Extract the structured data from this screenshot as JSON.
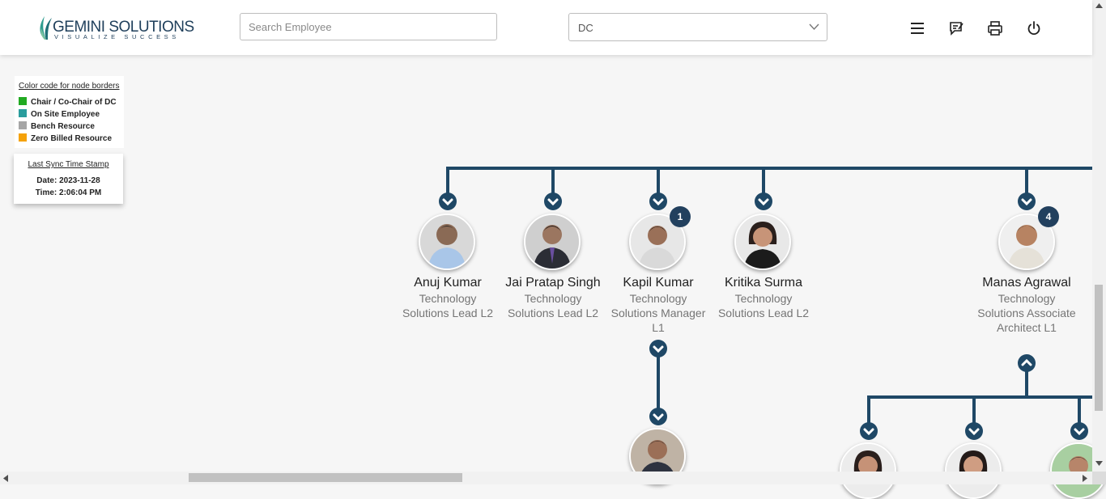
{
  "header": {
    "brand_name": "GEMINI SOLUTIONS",
    "brand_tagline": "VISUALIZE SUCCESS",
    "search_placeholder": "Search Employee",
    "department_value": "DC",
    "icons": [
      "menu-icon",
      "feedback-icon",
      "print-icon",
      "power-icon"
    ]
  },
  "legend": {
    "title": "Color code for node borders",
    "items": [
      {
        "label": "Chair / Co-Chair of DC",
        "color": "#22aa22"
      },
      {
        "label": "On Site Employee",
        "color": "#2a9d9d"
      },
      {
        "label": "Bench Resource",
        "color": "#a6a6a6"
      },
      {
        "label": "Zero Billed Resource",
        "color": "#f5a20a"
      }
    ]
  },
  "sync": {
    "title": "Last Sync Time Stamp",
    "date": "Date: 2023-11-28",
    "time": "Time: 2:06:04 PM"
  },
  "employees": [
    {
      "name": "Anuj Kumar",
      "title": "Technology Solutions Lead L2",
      "reports": null
    },
    {
      "name": "Jai Pratap Singh",
      "title": "Technology Solutions Lead L2",
      "reports": null
    },
    {
      "name": "Kapil Kumar",
      "title": "Technology Solutions Manager L1",
      "reports": "1"
    },
    {
      "name": "Kritika Surma",
      "title": "Technology Solutions Lead L2",
      "reports": null
    },
    {
      "name": "Manas Agrawal",
      "title": "Technology Solutions Associate Architect L1",
      "reports": "4"
    }
  ],
  "colors": {
    "connector": "#1f4866",
    "badge": "#22405e"
  }
}
